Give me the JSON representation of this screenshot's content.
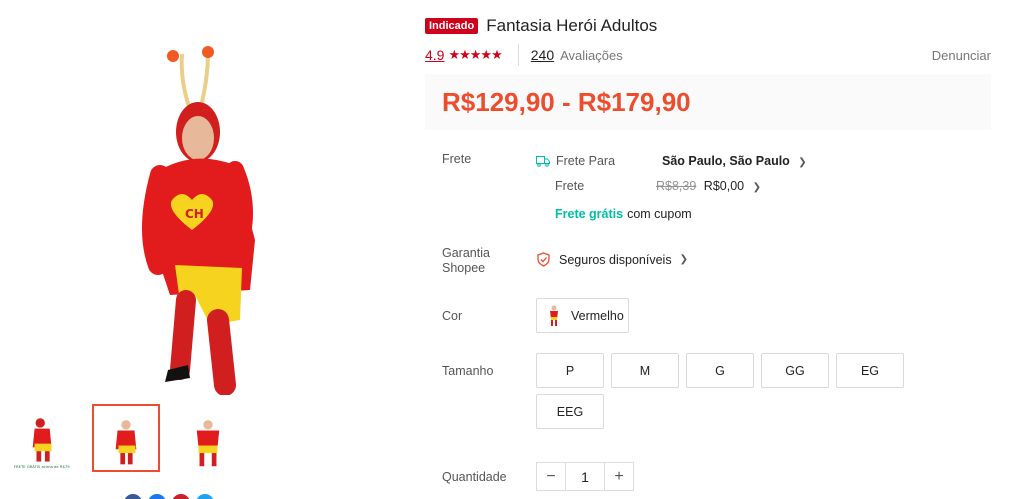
{
  "product": {
    "badge": "Indicado",
    "title": "Fantasia Herói Adultos",
    "rating": "4.9",
    "stars": "★★★★★",
    "review_count": "240",
    "review_label": "Avaliações",
    "report_label": "Denunciar",
    "price_range": "R$129,90 - R$179,90",
    "thumbnail_caption": "FRETE GRÁTIS acima de R$79"
  },
  "shipping": {
    "label": "Frete",
    "to_label": "Frete Para",
    "destination": "São Paulo, São Paulo",
    "fee_label": "Frete",
    "old_fee": "R$8,39",
    "fee": "R$0,00",
    "free_text": "Frete grátis",
    "coupon_text": "com cupom"
  },
  "guarantee": {
    "label": "Garantia Shopee",
    "value": "Seguros disponíveis"
  },
  "color": {
    "label": "Cor",
    "options": [
      "Vermelho"
    ]
  },
  "size": {
    "label": "Tamanho",
    "options": [
      "P",
      "M",
      "G",
      "GG",
      "EG",
      "EEG"
    ]
  },
  "quantity": {
    "label": "Quantidade",
    "value": "1",
    "minus": "−",
    "plus": "+"
  },
  "colors": {
    "accent": "#ee4d2d",
    "badge": "#d0011b",
    "free": "#00bfa5"
  }
}
